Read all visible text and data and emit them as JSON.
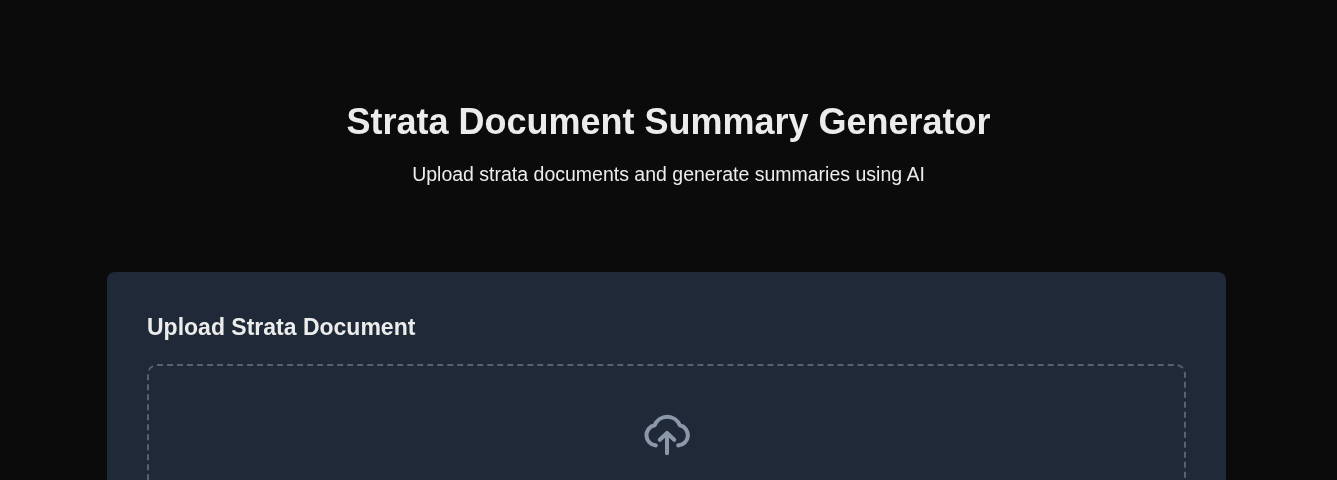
{
  "header": {
    "title": "Strata Document Summary Generator",
    "subtitle": "Upload strata documents and generate summaries using AI"
  },
  "upload_card": {
    "title": "Upload Strata Document"
  }
}
